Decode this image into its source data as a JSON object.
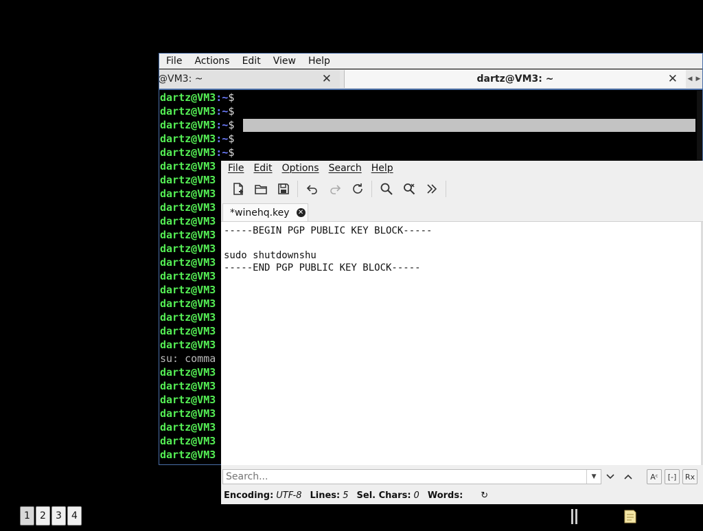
{
  "terminal": {
    "menu": [
      "File",
      "Actions",
      "Edit",
      "View",
      "Help"
    ],
    "tabs": [
      {
        "label": "@VM3: ~",
        "close": "✕"
      },
      {
        "label": "dartz@VM3: ~",
        "close": "✕"
      }
    ],
    "scroll_left": "◀",
    "scroll_right": "▶",
    "lines": [
      {
        "user": "dartz@VM3",
        "path": ":~",
        "dollar": "$"
      },
      {
        "user": "dartz@VM3",
        "path": ":~",
        "dollar": "$"
      },
      {
        "user": "dartz@VM3",
        "path": ":~",
        "dollar": "$",
        "selected": true
      },
      {
        "user": "dartz@VM3",
        "path": ":~",
        "dollar": "$"
      },
      {
        "user": "dartz@VM3",
        "path": ":~",
        "dollar": "$"
      },
      {
        "user": "dartz@VM3"
      },
      {
        "user": "dartz@VM3"
      },
      {
        "user": "dartz@VM3"
      },
      {
        "user": "dartz@VM3"
      },
      {
        "user": "dartz@VM3"
      },
      {
        "user": "dartz@VM3"
      },
      {
        "user": "dartz@VM3"
      },
      {
        "user": "dartz@VM3"
      },
      {
        "user": "dartz@VM3"
      },
      {
        "user": "dartz@VM3"
      },
      {
        "user": "dartz@VM3"
      },
      {
        "user": "dartz@VM3"
      },
      {
        "user": "dartz@VM3"
      },
      {
        "user": "dartz@VM3"
      },
      {
        "plain": "su: comma"
      },
      {
        "user": "dartz@VM3"
      },
      {
        "user": "dartz@VM3"
      },
      {
        "user": "dartz@VM3"
      },
      {
        "user": "dartz@VM3"
      },
      {
        "user": "dartz@VM3"
      },
      {
        "user": "dartz@VM3"
      },
      {
        "user": "dartz@VM3"
      }
    ]
  },
  "editor": {
    "menu": [
      "File",
      "Edit",
      "Options",
      "Search",
      "Help"
    ],
    "toolbar": {
      "new_icon": "new-document-icon",
      "open_icon": "folder-open-icon",
      "save_icon": "save-icon",
      "undo_icon": "undo-icon",
      "redo_icon": "redo-icon",
      "reload_icon": "reload-icon",
      "find_icon": "search-icon",
      "replace_icon": "find-replace-icon",
      "more_icon": "chevron-double-right-icon"
    },
    "tab": {
      "label": "*winehq.key",
      "close": "✕"
    },
    "text_lines": [
      "-----BEGIN PGP PUBLIC KEY BLOCK-----",
      "",
      "sudo shutdownshu",
      "-----END PGP PUBLIC KEY BLOCK-----"
    ],
    "search": {
      "placeholder": "Search...",
      "down": "⌄",
      "up": "⌃",
      "opt_case": "Aᶜ",
      "opt_word": "[-]",
      "opt_regex": "Rx"
    },
    "status": {
      "encoding_label": "Encoding:",
      "encoding_value": "UTF-8",
      "lines_label": "Lines:",
      "lines_value": "5",
      "sel_label": "Sel. Chars:",
      "sel_value": "0",
      "words_label": "Words:",
      "refresh": "↻"
    }
  },
  "pager": [
    "1",
    "2",
    "3",
    "4"
  ]
}
